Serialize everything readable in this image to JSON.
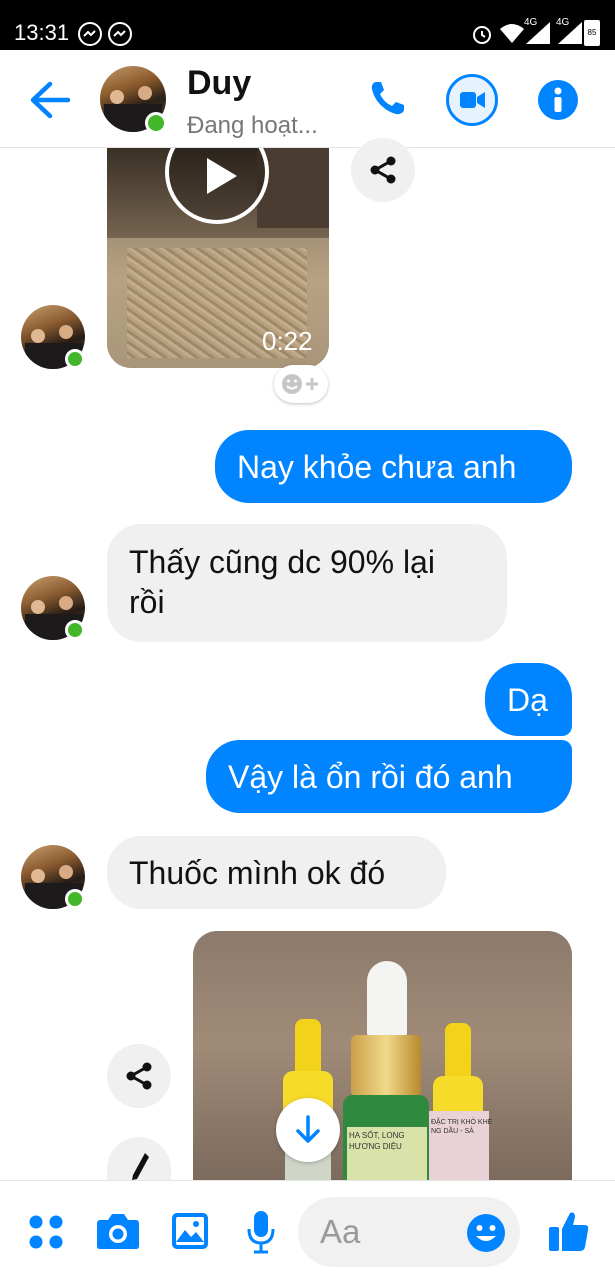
{
  "status_bar": {
    "time": "13:31",
    "network_left": "4G",
    "network_right": "4G",
    "battery": "85"
  },
  "header": {
    "contact_name": "Duy",
    "status": "Đang hoạt...",
    "icons": [
      "back-arrow-icon",
      "phone-icon",
      "video-call-icon",
      "info-icon"
    ]
  },
  "messages": {
    "video": {
      "duration": "0:22"
    },
    "msg1": "Nay khỏe chưa anh",
    "msg2_line1": "Thấy cũng dc 90% lại",
    "msg2_line2": "rồi",
    "msg3": "Dạ",
    "msg4": "Vậy là ổn rồi đó anh",
    "msg5": "Thuốc mình ok đó"
  },
  "photo": {
    "label_left_1": "HA SỐT, LONG",
    "label_left_2": "HƯƠNG DIỆU",
    "label_right_1": "ĐẶC TRỊ KHÒ KHÈ",
    "label_right_2": "NG DẦU - SẢ"
  },
  "composer": {
    "placeholder": "Aa",
    "icons": [
      "apps-icon",
      "camera-icon",
      "gallery-icon",
      "microphone-icon",
      "emoji-icon",
      "thumbs-up-icon"
    ]
  },
  "colors": {
    "accent": "#0084ff",
    "incoming_bubble": "#f0f0f0",
    "online": "#42b72a"
  }
}
